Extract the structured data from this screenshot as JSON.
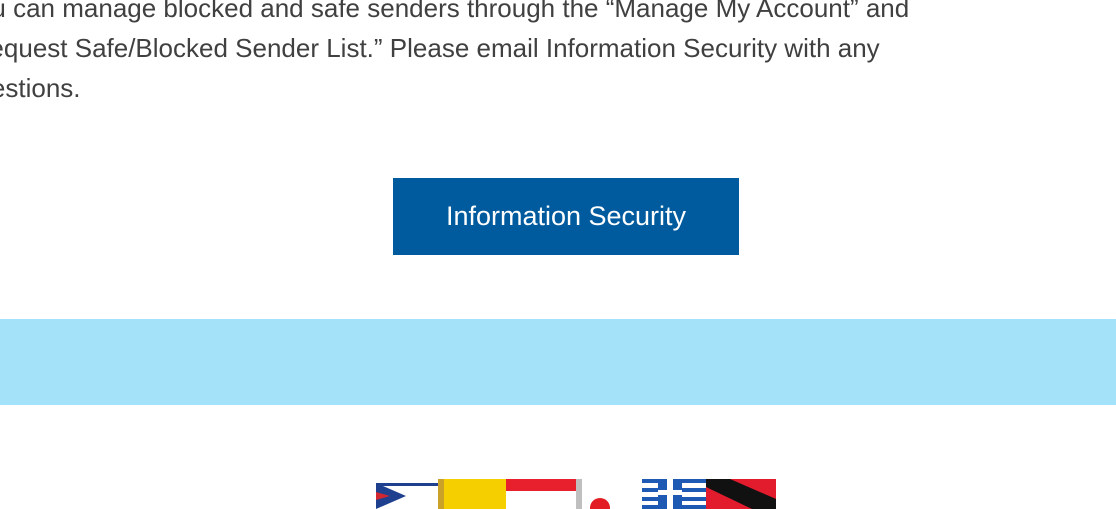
{
  "body": {
    "paragraph": "You can manage blocked and safe senders through the “Manage My Account” and\n“Request Safe/Blocked Sender List.” Please email Information Security with any\nquestions."
  },
  "cta": {
    "label": "Information Security"
  },
  "colors": {
    "button_bg": "#005a9e",
    "band_bg": "#a3e2f8",
    "text": "#404040"
  },
  "footer_image": {
    "icon": "flags-banner-image"
  }
}
